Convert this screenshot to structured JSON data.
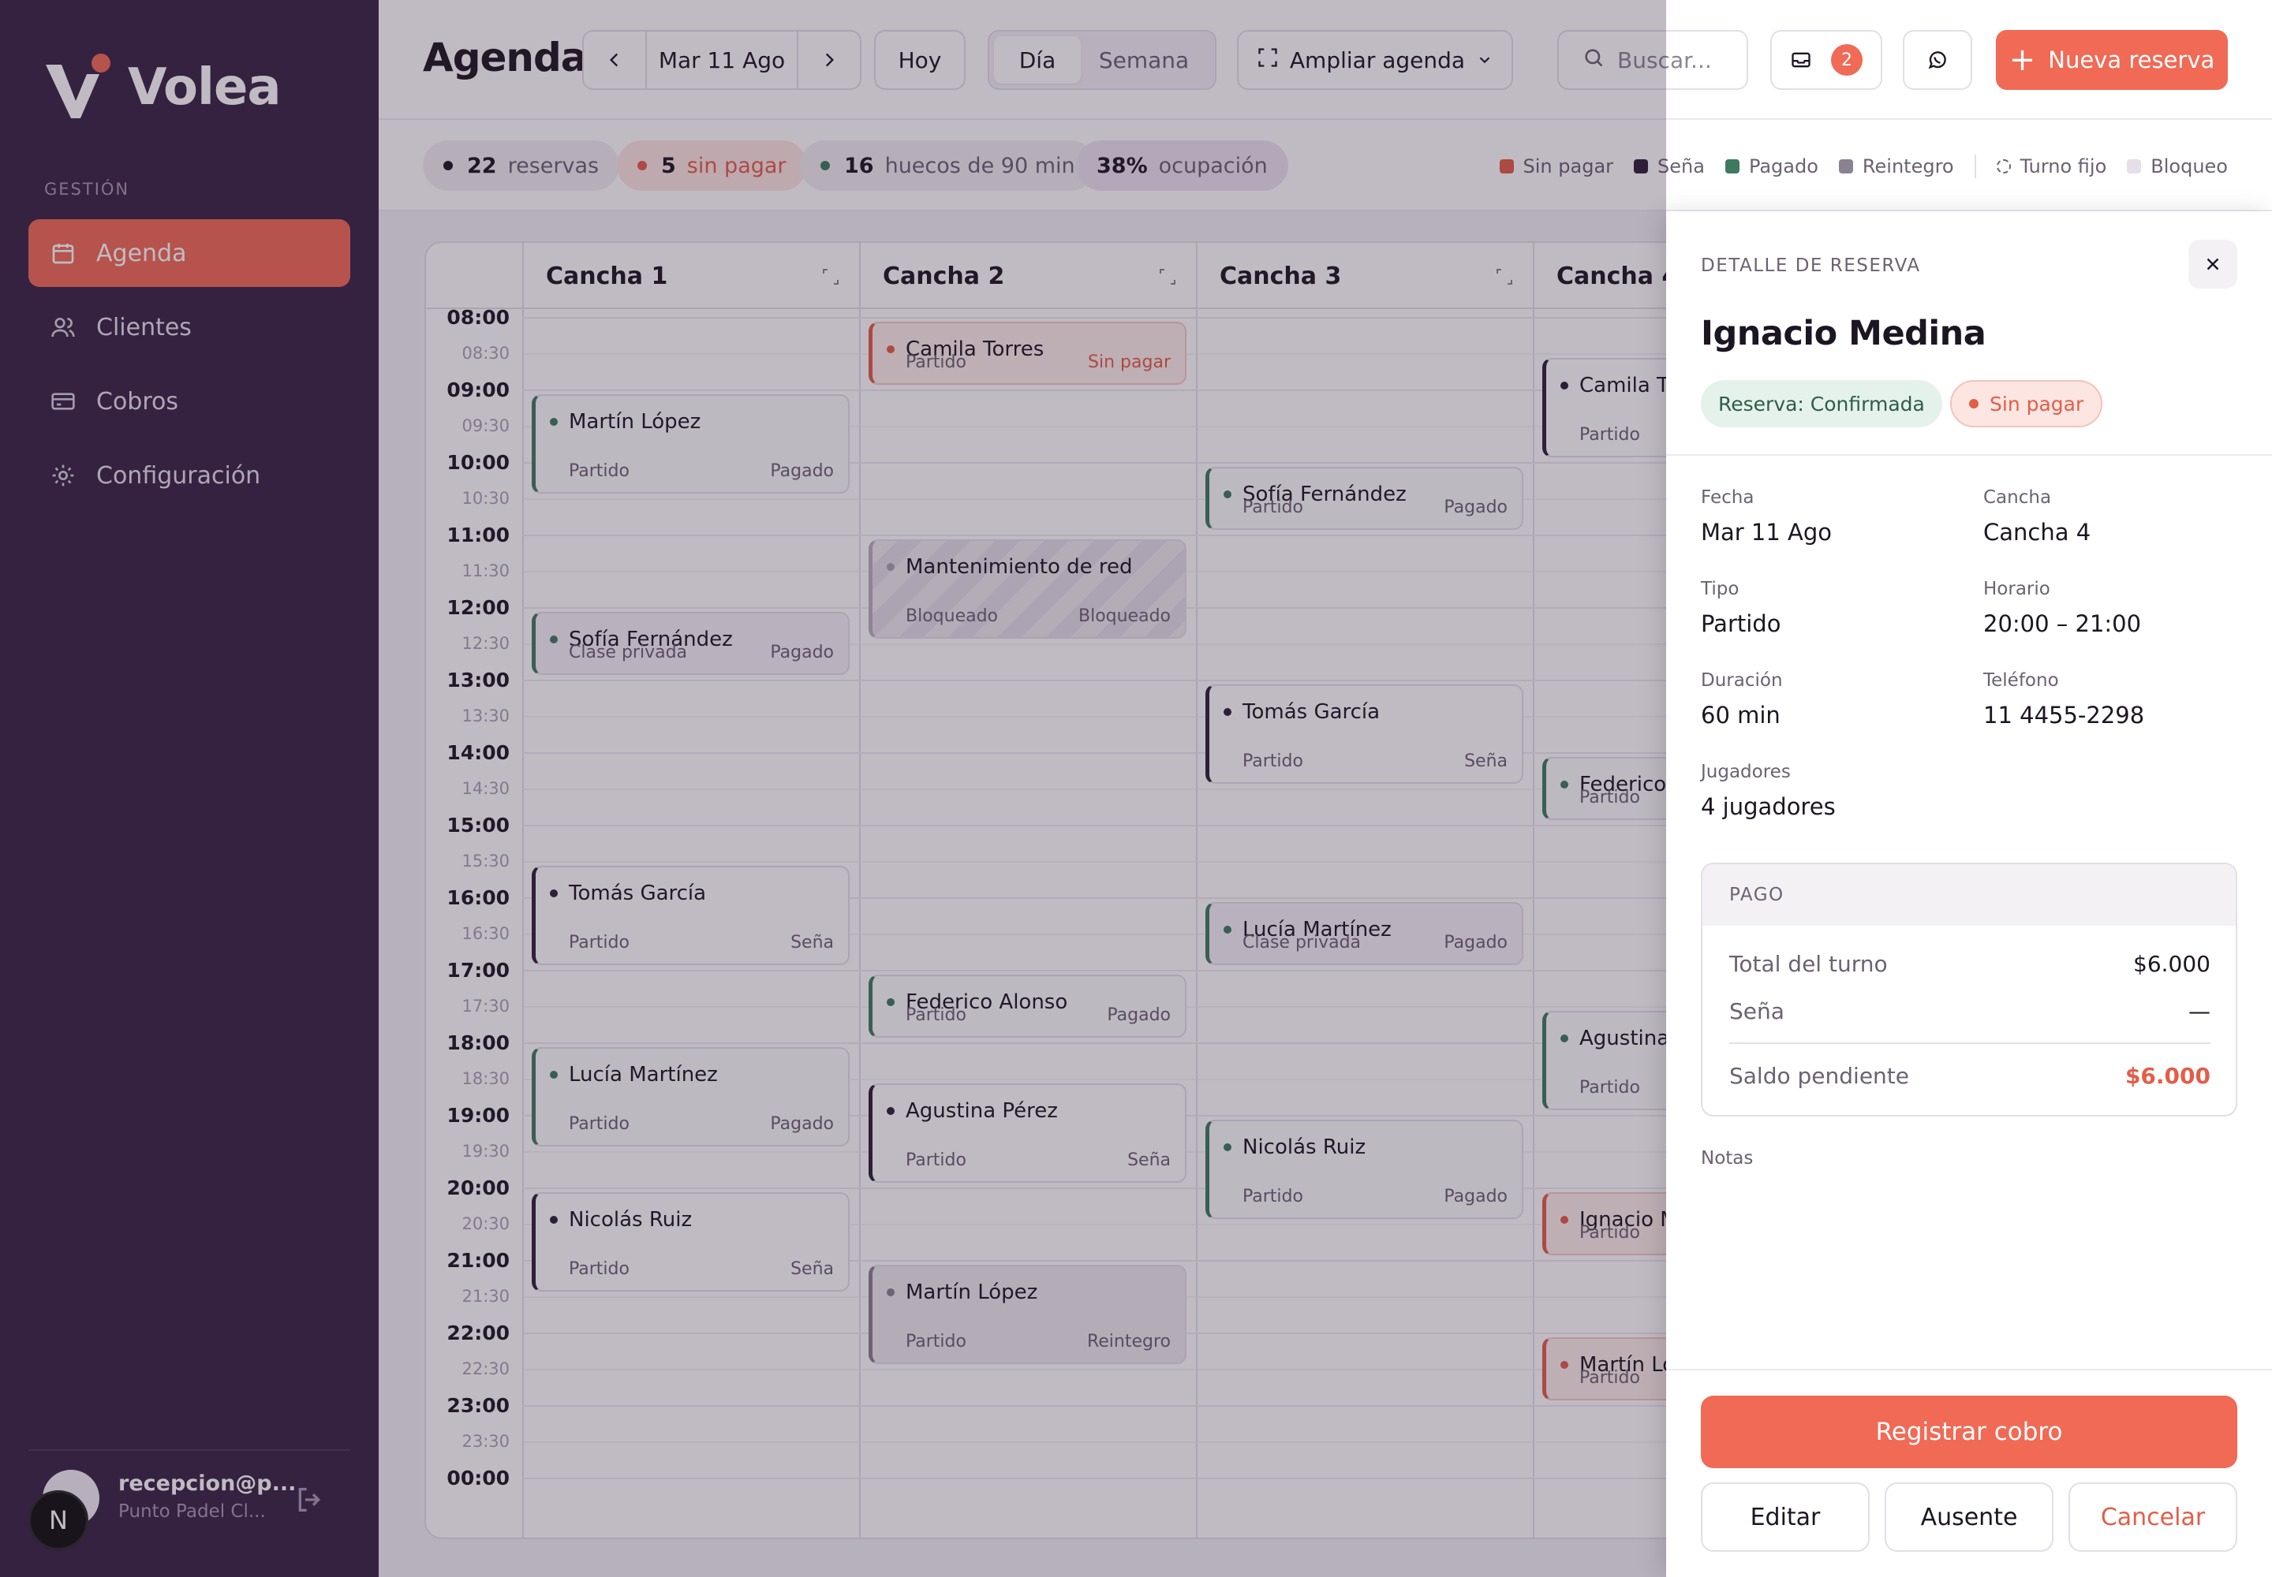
{
  "app": {
    "name": "Volea",
    "brand_color": "#f06a55",
    "sidebar_color": "#372444"
  },
  "sidebar": {
    "section": "GESTIÓN",
    "items": [
      {
        "label": "Agenda",
        "icon": "calendar-icon",
        "active": true
      },
      {
        "label": "Clientes",
        "icon": "users-icon",
        "active": false
      },
      {
        "label": "Cobros",
        "icon": "credit-card-icon",
        "active": false
      },
      {
        "label": "Configuración",
        "icon": "gear-icon",
        "active": false
      }
    ],
    "user": {
      "email": "recepcion@p...",
      "club": "Punto Padel Cl...",
      "badge": "N"
    }
  },
  "header": {
    "title": "Agenda",
    "date": "Mar 11 Ago",
    "today": "Hoy",
    "view_day": "Día",
    "view_week": "Semana",
    "expand": "Ampliar agenda",
    "search_placeholder": "Buscar...",
    "inbox_count": "2",
    "new_booking": "Nueva reserva"
  },
  "stats": {
    "reservas": {
      "value": "22",
      "label": "reservas"
    },
    "sin_pagar": {
      "value": "5",
      "label": "sin pagar"
    },
    "huecos": {
      "value": "16",
      "label": "huecos de 90 min"
    },
    "ocupacion": {
      "value": "38%",
      "label": "ocupación"
    }
  },
  "legend": [
    {
      "label": "Sin pagar",
      "color": "#e35d48"
    },
    {
      "label": "Seña",
      "color": "#2e2038"
    },
    {
      "label": "Pagado",
      "color": "#3f7a60"
    },
    {
      "label": "Reintegro",
      "color": "#8a8290"
    },
    {
      "label": "Turno fijo",
      "color": "dashed"
    },
    {
      "label": "Bloqueo",
      "color": "#e4dfe8"
    }
  ],
  "calendar": {
    "courts": [
      "Cancha 1",
      "Cancha 2",
      "Cancha 3",
      "Cancha 4"
    ],
    "times": [
      "08:00",
      "08:30",
      "09:00",
      "09:30",
      "10:00",
      "10:30",
      "11:00",
      "11:30",
      "12:00",
      "12:30",
      "13:00",
      "13:30",
      "14:00",
      "14:30",
      "15:00",
      "15:30",
      "16:00",
      "16:30",
      "17:00",
      "17:30",
      "18:00",
      "18:30",
      "19:00",
      "19:30",
      "20:00",
      "20:30",
      "21:00",
      "21:30",
      "22:00",
      "22:30",
      "23:00",
      "23:30",
      "00:00"
    ],
    "events": [
      {
        "court": 0,
        "start": "09:00",
        "end": "10:30",
        "name": "Martín López",
        "type": "Partido",
        "status": "Pagado",
        "kind": "pagado"
      },
      {
        "court": 0,
        "start": "12:00",
        "end": "13:00",
        "name": "Sofía Fernández",
        "type": "Clase privada",
        "status": "Pagado",
        "kind": "pagado clase"
      },
      {
        "court": 0,
        "start": "15:30",
        "end": "17:00",
        "name": "Tomás García",
        "type": "Partido",
        "status": "Seña",
        "kind": "sena"
      },
      {
        "court": 0,
        "start": "18:00",
        "end": "19:30",
        "name": "Lucía Martínez",
        "type": "Partido",
        "status": "Pagado",
        "kind": "pagado"
      },
      {
        "court": 0,
        "start": "20:00",
        "end": "21:30",
        "name": "Nicolás Ruiz",
        "type": "Partido",
        "status": "Seña",
        "kind": "sena"
      },
      {
        "court": 1,
        "start": "08:00",
        "end": "09:00",
        "name": "Camila Torres",
        "type": "Partido",
        "status": "Sin pagar",
        "kind": "sinpagar"
      },
      {
        "court": 1,
        "start": "11:00",
        "end": "12:30",
        "name": "Mantenimiento de red",
        "type": "Bloqueado",
        "status": "Bloqueado",
        "kind": "bloq"
      },
      {
        "court": 1,
        "start": "17:00",
        "end": "18:00",
        "name": "Federico Alonso",
        "type": "Partido",
        "status": "Pagado",
        "kind": "pagado"
      },
      {
        "court": 1,
        "start": "18:30",
        "end": "20:00",
        "name": "Agustina Pérez",
        "type": "Partido",
        "status": "Seña",
        "kind": "sena"
      },
      {
        "court": 1,
        "start": "21:00",
        "end": "22:30",
        "name": "Martín López",
        "type": "Partido",
        "status": "Reintegro",
        "kind": "reint"
      },
      {
        "court": 2,
        "start": "10:00",
        "end": "11:00",
        "name": "Sofía Fernández",
        "type": "Partido",
        "status": "Pagado",
        "kind": "pagado"
      },
      {
        "court": 2,
        "start": "13:00",
        "end": "14:30",
        "name": "Tomás García",
        "type": "Partido",
        "status": "Seña",
        "kind": "sena"
      },
      {
        "court": 2,
        "start": "16:00",
        "end": "17:00",
        "name": "Lucía Martínez",
        "type": "Clase privada",
        "status": "Pagado",
        "kind": "pagado clase"
      },
      {
        "court": 2,
        "start": "19:00",
        "end": "20:30",
        "name": "Nicolás Ruiz",
        "type": "Partido",
        "status": "Pagado",
        "kind": "pagado"
      },
      {
        "court": 3,
        "start": "08:30",
        "end": "10:00",
        "name": "Camila To",
        "type": "Partido",
        "status": "",
        "kind": "sena"
      },
      {
        "court": 3,
        "start": "14:00",
        "end": "15:00",
        "name": "Federico A",
        "type": "Partido",
        "status": "",
        "kind": "pagado"
      },
      {
        "court": 3,
        "start": "17:30",
        "end": "19:00",
        "name": "Agustina",
        "type": "Partido",
        "status": "",
        "kind": "pagado"
      },
      {
        "court": 3,
        "start": "20:00",
        "end": "21:00",
        "name": "Ignacio M",
        "type": "Partido",
        "status": "",
        "kind": "sinpagar"
      },
      {
        "court": 3,
        "start": "22:00",
        "end": "23:00",
        "name": "Martín Ló",
        "type": "Partido",
        "status": "",
        "kind": "sinpagar"
      }
    ]
  },
  "detail": {
    "label": "DETALLE DE RESERVA",
    "name": "Ignacio Medina",
    "state_tag": "Reserva: Confirmada",
    "pay_tag": "Sin pagar",
    "fields": {
      "fecha": {
        "k": "Fecha",
        "v": "Mar 11 Ago"
      },
      "cancha": {
        "k": "Cancha",
        "v": "Cancha 4"
      },
      "tipo": {
        "k": "Tipo",
        "v": "Partido"
      },
      "horario": {
        "k": "Horario",
        "v": "20:00 – 21:00"
      },
      "duracion": {
        "k": "Duración",
        "v": "60 min"
      },
      "telefono": {
        "k": "Teléfono",
        "v": "11 4455-2298"
      },
      "jugadores": {
        "k": "Jugadores",
        "v": "4 jugadores"
      }
    },
    "payment": {
      "title": "PAGO",
      "total_label": "Total del turno",
      "total": "$6.000",
      "sena_label": "Seña",
      "sena": "—",
      "saldo_label": "Saldo pendiente",
      "saldo": "$6.000"
    },
    "notes_label": "Notas",
    "actions": {
      "cobro": "Registrar cobro",
      "editar": "Editar",
      "ausente": "Ausente",
      "cancelar": "Cancelar"
    }
  }
}
